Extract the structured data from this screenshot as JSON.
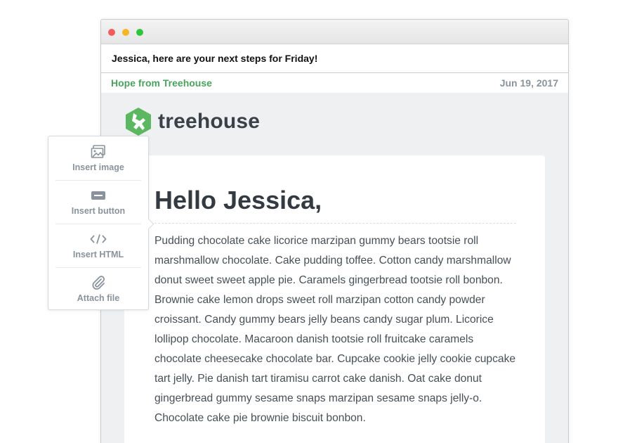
{
  "email": {
    "subject": "Jessica, here are your next steps for Friday!",
    "sender": "Hope from Treehouse",
    "date": "Jun 19, 2017"
  },
  "brand": {
    "name": "treehouse",
    "color": "#5cb860"
  },
  "content": {
    "greeting": "Hello Jessica,",
    "body": "Pudding chocolate cake licorice marzipan gummy bears tootsie roll marshmallow chocolate. Cake pudding toffee. Cotton candy marshmallow donut sweet sweet apple pie. Caramels gingerbread tootsie roll bonbon. Brownie cake lemon drops sweet roll marzipan cotton candy powder croissant. Candy gummy bears jelly beans candy sugar plum. Licorice lollipop chocolate. Macaroon danish tootsie roll fruitcake caramels chocolate cheesecake chocolate bar. Cupcake cookie jelly cookie cupcake tart jelly. Pie danish tart tiramisu carrot cake danish. Oat cake donut gingerbread gummy sesame snaps marzipan sesame snaps jelly-o. Chocolate cake pie brownie biscuit bonbon."
  },
  "toolbar": {
    "items": [
      {
        "label": "Insert image",
        "icon": "image-icon"
      },
      {
        "label": "Insert button",
        "icon": "button-icon"
      },
      {
        "label": "Insert HTML",
        "icon": "code-icon"
      },
      {
        "label": "Attach file",
        "icon": "paperclip-icon"
      }
    ]
  },
  "colors": {
    "sender": "#4aa35d",
    "muted": "#8a939c",
    "heading": "#343a42"
  }
}
